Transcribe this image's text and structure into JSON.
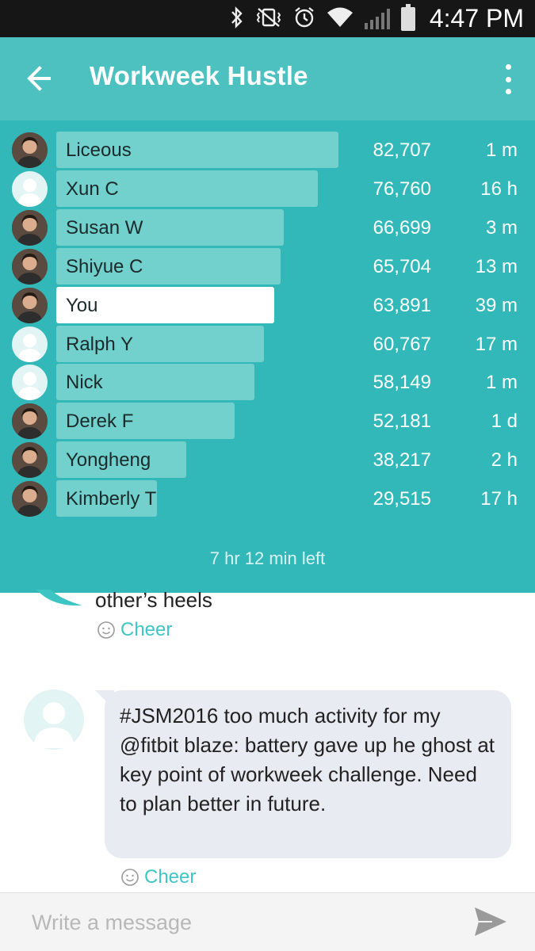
{
  "status_bar": {
    "time": "4:47 PM",
    "icons": [
      "bluetooth-icon",
      "vibrate-mute-icon",
      "alarm-icon",
      "wifi-icon",
      "signal-icon",
      "battery-icon"
    ]
  },
  "header": {
    "title": "Workweek Hustle",
    "background": "#4dc0c0"
  },
  "leaderboard": {
    "background": "#33b8b9",
    "bar_color": "#72d0cd",
    "self_bar_color": "#ffffff",
    "entries": [
      {
        "name": "Liceous",
        "steps": "82,707",
        "steps_value": 82707,
        "last_sync": "1 m",
        "avatar": "photo"
      },
      {
        "name": "Xun C",
        "steps": "76,760",
        "steps_value": 76760,
        "last_sync": "16 h",
        "avatar": "default"
      },
      {
        "name": "Susan W",
        "steps": "66,699",
        "steps_value": 66699,
        "last_sync": "3 m",
        "avatar": "photo"
      },
      {
        "name": "Shiyue C",
        "steps": "65,704",
        "steps_value": 65704,
        "last_sync": "13 m",
        "avatar": "photo"
      },
      {
        "name": "You",
        "steps": "63,891",
        "steps_value": 63891,
        "last_sync": "39 m",
        "avatar": "photo",
        "is_self": true
      },
      {
        "name": "Ralph Y",
        "steps": "60,767",
        "steps_value": 60767,
        "last_sync": "17 m",
        "avatar": "default"
      },
      {
        "name": "Nick",
        "steps": "58,149",
        "steps_value": 58149,
        "last_sync": "1 m",
        "avatar": "default"
      },
      {
        "name": "Derek F",
        "steps": "52,181",
        "steps_value": 52181,
        "last_sync": "1 d",
        "avatar": "photo"
      },
      {
        "name": "Yongheng",
        "steps": "38,217",
        "steps_value": 38217,
        "last_sync": "2 h",
        "avatar": "photo"
      },
      {
        "name": "Kimberly T",
        "steps": "29,515",
        "steps_value": 29515,
        "last_sync": "17 h",
        "avatar": "photo"
      }
    ],
    "time_left": "7 hr 12 min left"
  },
  "feed": {
    "partial_message_tail": "other’s heels",
    "cheer_label_1": "Cheer",
    "post_text": "#JSM2016 too much activity for my @fitbit blaze: battery gave up he ghost at key point of workweek challenge. Need to plan better in future.",
    "cheer_label_2": "Cheer"
  },
  "composer": {
    "placeholder": "Write a message"
  }
}
